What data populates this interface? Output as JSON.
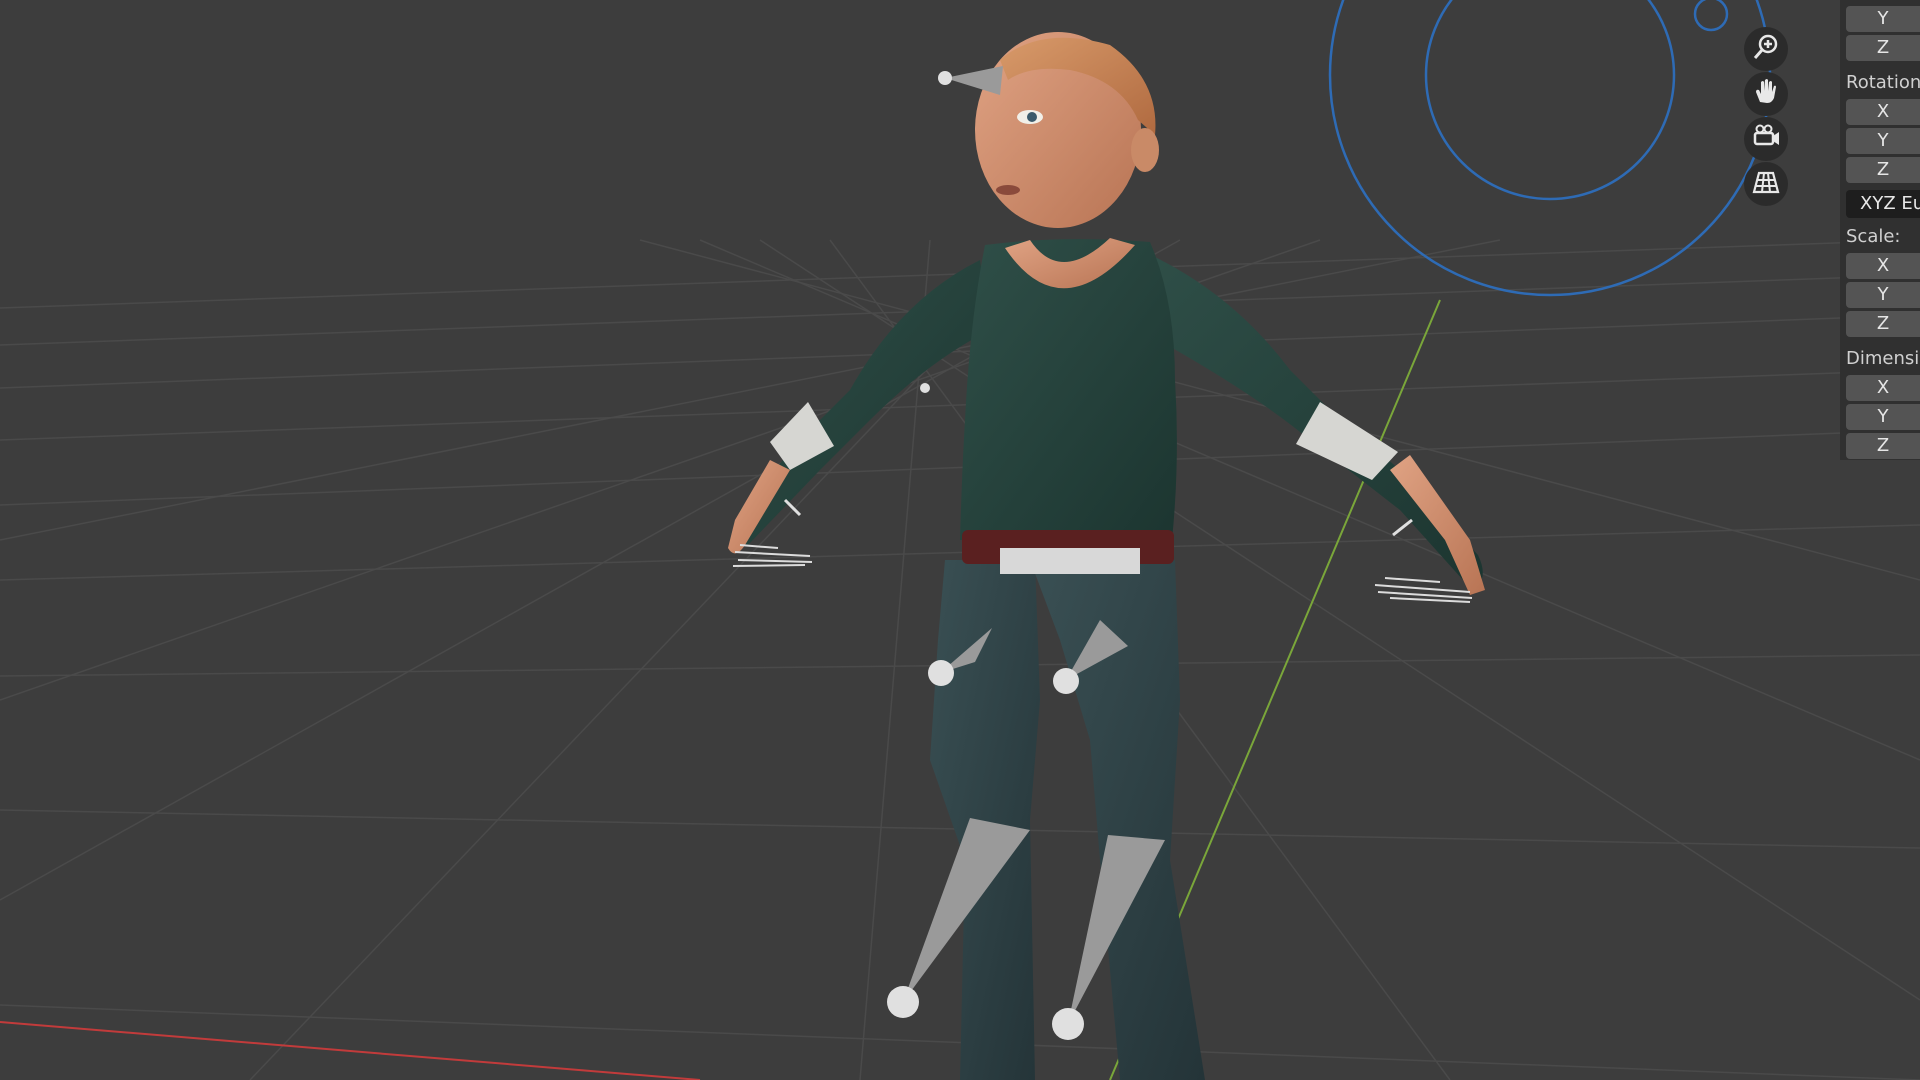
{
  "viewport": {
    "background_color": "#3d3d3d",
    "grid_color": "#4a4a4a",
    "x_axis_color": "#c23b3b",
    "y_axis_color": "#7aa63a",
    "gizmo_color": "#2e6bb5"
  },
  "nav_gizmo": {
    "buttons": [
      {
        "icon": "zoom-icon"
      },
      {
        "icon": "hand-pan-icon"
      },
      {
        "icon": "camera-icon"
      },
      {
        "icon": "grid-perspective-icon"
      }
    ]
  },
  "properties": {
    "location": {
      "y": "Y",
      "z": "Z"
    },
    "rotation": {
      "label": "Rotation",
      "x": "X",
      "y": "Y",
      "z": "Z",
      "mode": "XYZ Euler"
    },
    "scale": {
      "label": "Scale:",
      "x": "X",
      "y": "Y",
      "z": "Z"
    },
    "dimensions": {
      "label": "Dimensions:",
      "x": "X",
      "y": "Y",
      "z": "Z"
    }
  }
}
